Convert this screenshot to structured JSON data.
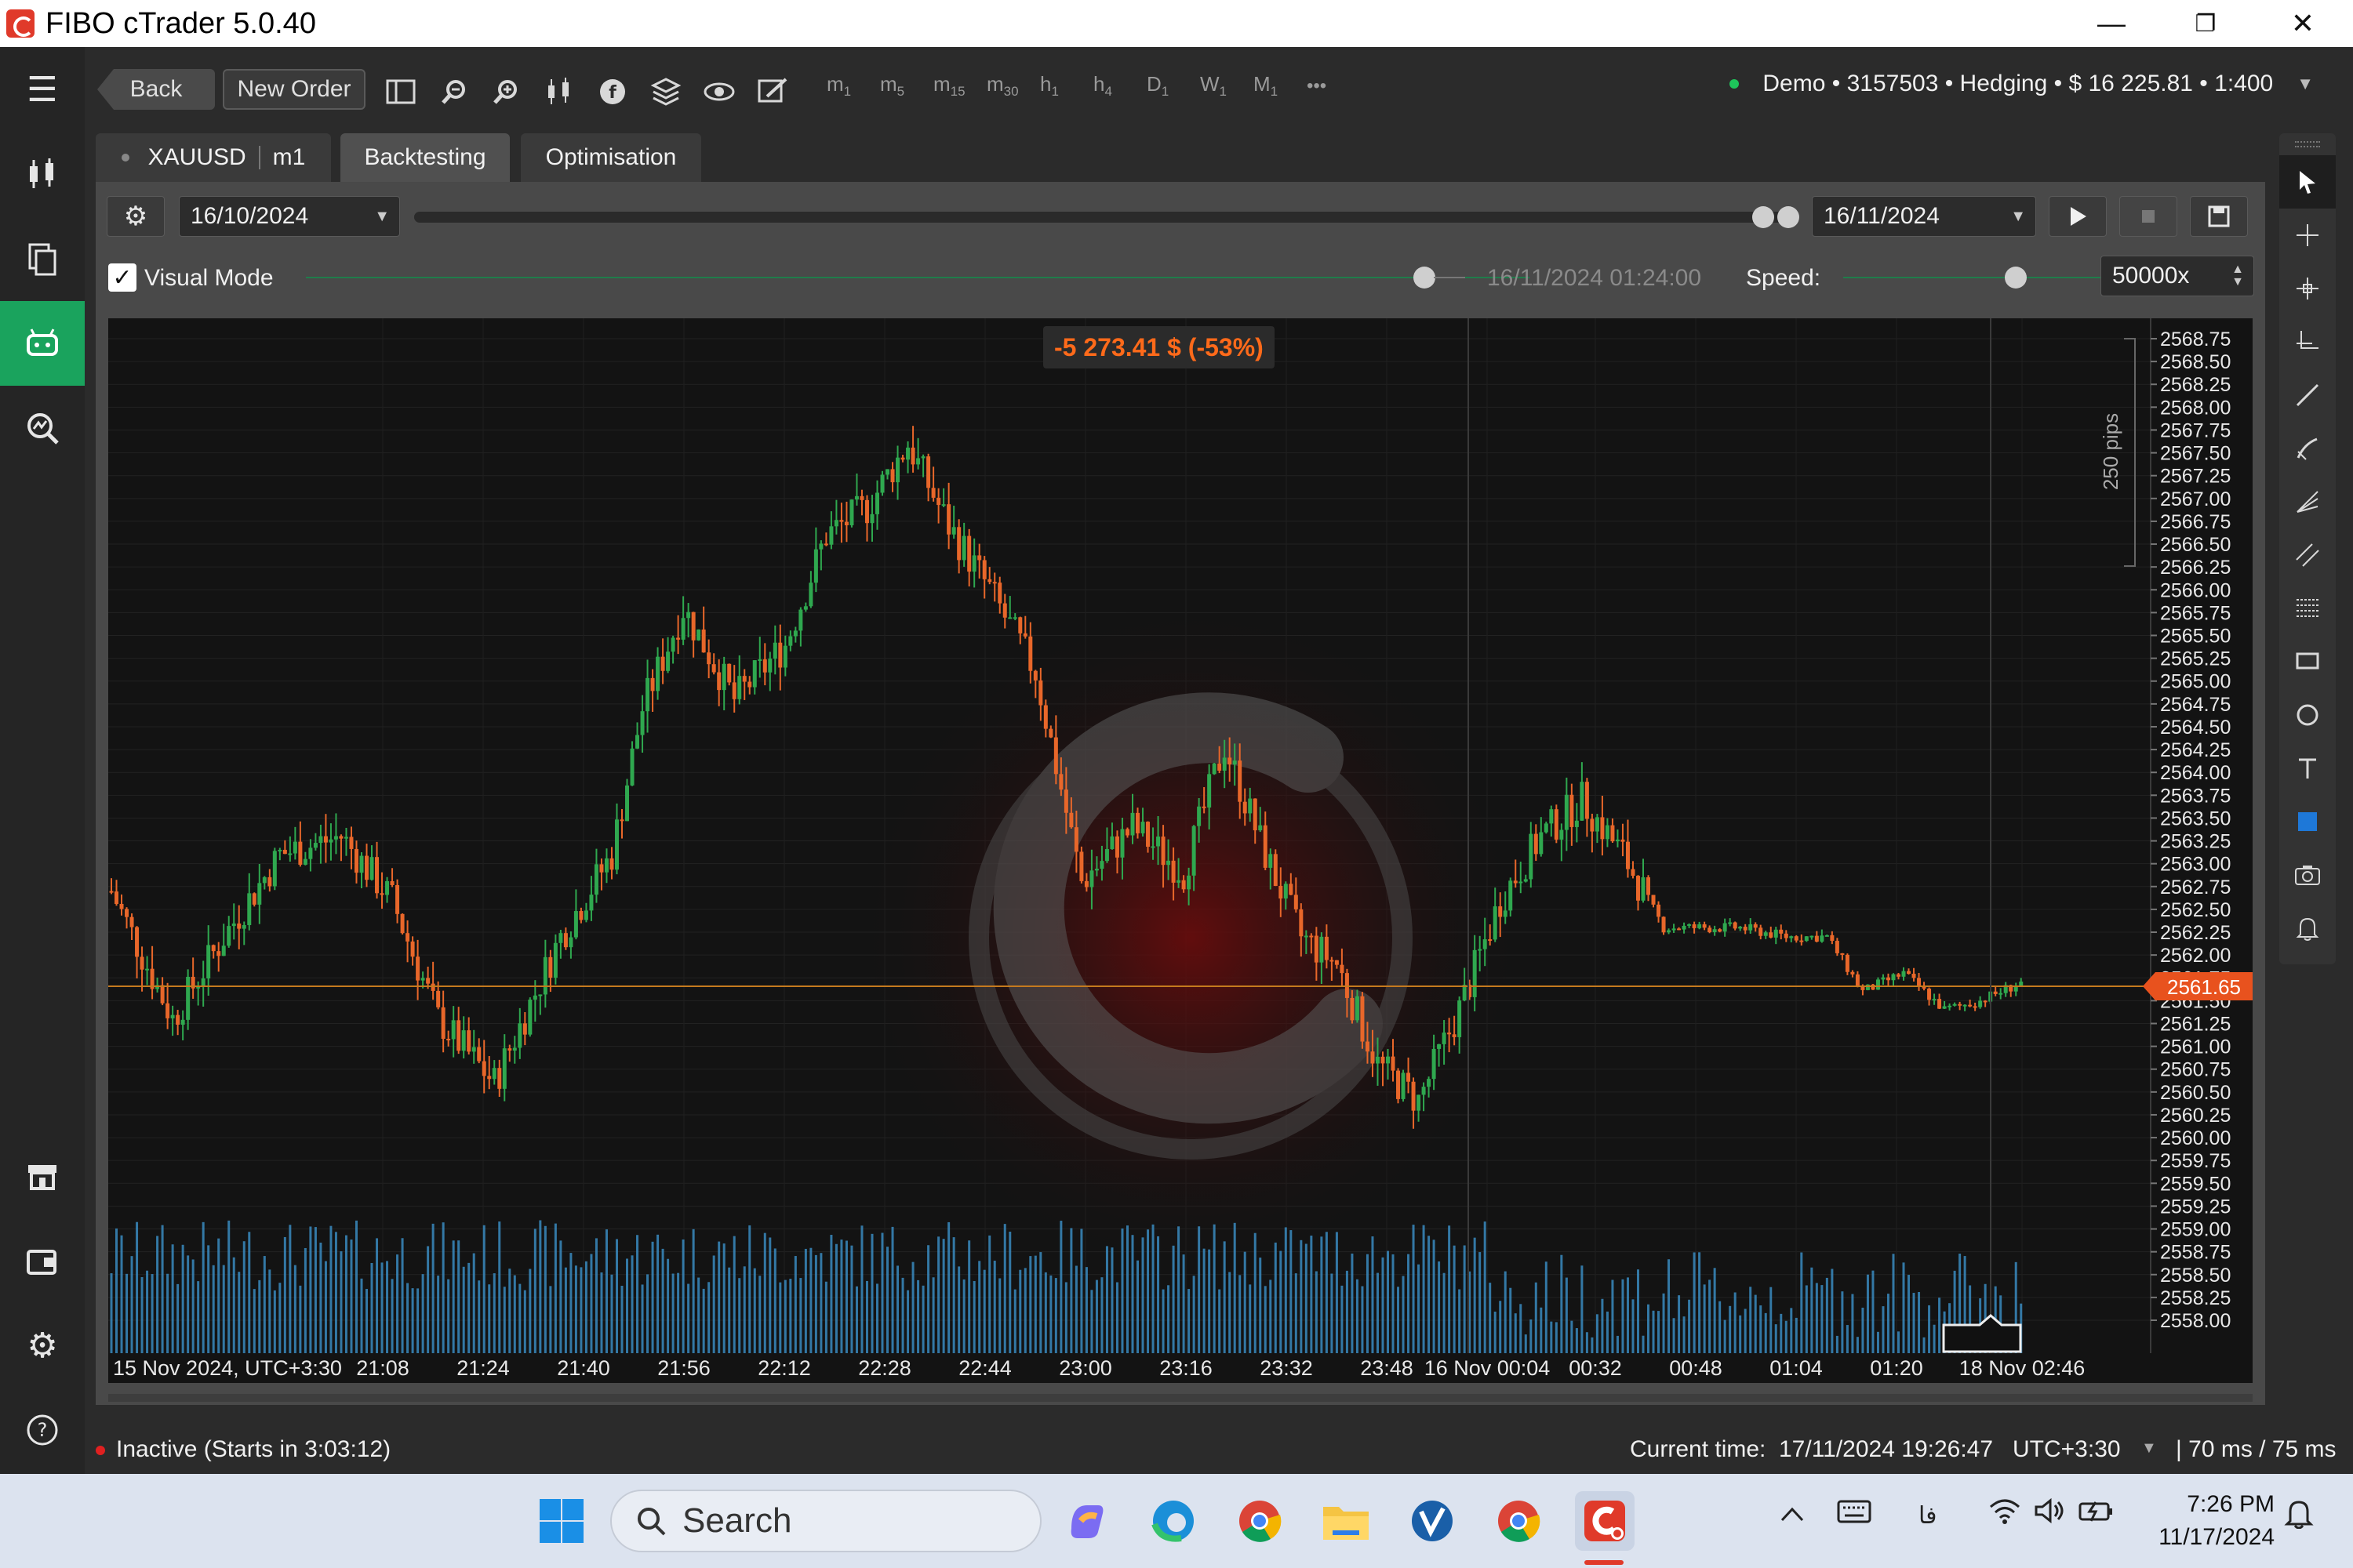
{
  "window": {
    "title": "FIBO cTrader 5.0.40",
    "minimize": "—",
    "maximize": "❐",
    "close": "✕"
  },
  "toolbar": {
    "back_label": "Back",
    "new_order_label": "New Order",
    "timeframes": [
      {
        "main": "m",
        "sub": "1"
      },
      {
        "main": "m",
        "sub": "5"
      },
      {
        "main": "m",
        "sub": "15"
      },
      {
        "main": "m",
        "sub": "30"
      },
      {
        "main": "h",
        "sub": "1"
      },
      {
        "main": "h",
        "sub": "4"
      },
      {
        "main": "D",
        "sub": "1"
      },
      {
        "main": "W",
        "sub": "1"
      },
      {
        "main": "M",
        "sub": "1"
      }
    ],
    "more": "•••",
    "account": "Demo • 3157503 • Hedging • $ 16 225.81 • 1:400",
    "account_arrow": "▼"
  },
  "tabs": {
    "symbol": "XAUUSD",
    "timeframe": "m1",
    "backtesting": "Backtesting",
    "optimisation": "Optimisation"
  },
  "backtest": {
    "start_date": "16/10/2024",
    "end_date": "16/11/2024",
    "visual_mode_label": "Visual Mode",
    "visual_mode_checked": true,
    "current_bar_time": "16/11/2024 01:24:00",
    "speed_label": "Speed:",
    "speed_value": "50000x"
  },
  "chart": {
    "pnl": "-5 273.41 $ (-53%)",
    "pips_label": "250 pips",
    "current_price": "2561.65",
    "colors": {
      "up": "#2fa84f",
      "down": "#e8672a",
      "volume": "#3a8bbf",
      "price_tag": "#e8521e"
    }
  },
  "chart_data": {
    "type": "candlestick",
    "symbol": "XAUUSD",
    "timeframe": "m1",
    "y_ticks": [
      "2568.75",
      "2568.50",
      "2568.25",
      "2568.00",
      "2567.75",
      "2567.50",
      "2567.25",
      "2567.00",
      "2566.75",
      "2566.50",
      "2566.25",
      "2566.00",
      "2565.75",
      "2565.50",
      "2565.25",
      "2565.00",
      "2564.75",
      "2564.50",
      "2564.25",
      "2564.00",
      "2563.75",
      "2563.50",
      "2563.25",
      "2563.00",
      "2562.75",
      "2562.50",
      "2562.25",
      "2562.00",
      "2561.75",
      "2561.50",
      "2561.25",
      "2561.00",
      "2560.75",
      "2560.50",
      "2560.25",
      "2560.00",
      "2559.75",
      "2559.50",
      "2559.25",
      "2559.00",
      "2558.75",
      "2558.50",
      "2558.25",
      "2558.00"
    ],
    "ylim": [
      2557.85,
      2568.95
    ],
    "x_ticks": [
      "15 Nov 2024, UTC+3:30",
      "21:08",
      "21:24",
      "21:40",
      "21:56",
      "22:12",
      "22:28",
      "22:44",
      "23:00",
      "23:16",
      "23:32",
      "23:48",
      "16 Nov 00:04",
      "00:32",
      "00:48",
      "01:04",
      "01:20",
      "18 Nov 02:46"
    ],
    "close_path": [
      [
        0,
        2562.7
      ],
      [
        12,
        2561.3
      ],
      [
        22,
        2562.2
      ],
      [
        33,
        2563.1
      ],
      [
        45,
        2563.3
      ],
      [
        55,
        2562.6
      ],
      [
        64,
        2561.3
      ],
      [
        75,
        2560.6
      ],
      [
        88,
        2562.2
      ],
      [
        98,
        2563.1
      ],
      [
        104,
        2564.7
      ],
      [
        112,
        2565.8
      ],
      [
        122,
        2564.8
      ],
      [
        132,
        2565.4
      ],
      [
        140,
        2566.6
      ],
      [
        148,
        2566.9
      ],
      [
        156,
        2567.6
      ],
      [
        164,
        2566.7
      ],
      [
        172,
        2566.0
      ],
      [
        181,
        2565.1
      ],
      [
        190,
        2562.8
      ],
      [
        200,
        2563.4
      ],
      [
        210,
        2562.9
      ],
      [
        218,
        2564.3
      ],
      [
        226,
        2563.1
      ],
      [
        233,
        2562.2
      ],
      [
        240,
        2561.9
      ],
      [
        248,
        2560.8
      ],
      [
        256,
        2560.4
      ],
      [
        264,
        2561.4
      ],
      [
        272,
        2562.6
      ],
      [
        280,
        2563.3
      ],
      [
        288,
        2563.7
      ],
      [
        296,
        2563.1
      ],
      [
        304,
        2562.3
      ],
      [
        311,
        2562.3
      ],
      [
        319,
        2562.3
      ],
      [
        328,
        2562.2
      ],
      [
        336,
        2562.2
      ],
      [
        343,
        2561.6
      ],
      [
        351,
        2561.8
      ],
      [
        359,
        2561.4
      ],
      [
        366,
        2561.5
      ],
      [
        374,
        2561.7
      ]
    ],
    "last_price": 2561.65,
    "pnl": "-5 273.41 $ (-53%)"
  },
  "right_tools": [
    "cursor-icon",
    "crosshair-icon",
    "crosshair-alt-icon",
    "quick-measure-icon",
    "trend-line-icon",
    "pen-icon",
    "fib-fan-icon",
    "parallel-channel-icon",
    "fib-retracement-icon",
    "rectangle-icon",
    "ellipse-icon",
    "text-icon",
    "color-square-icon",
    "camera-icon",
    "alert-bell-icon"
  ],
  "status": {
    "state": "Inactive (Starts in 3:03:12)",
    "current_time_label": "Current time:",
    "current_time": "17/11/2024 19:26:47",
    "tz": "UTC+3:30",
    "tz_arrow": "▼",
    "latency": "|  70 ms / 75 ms"
  },
  "taskbar": {
    "search_placeholder": "Search",
    "lang": "فا",
    "time": "7:26 PM",
    "date": "11/17/2024"
  }
}
